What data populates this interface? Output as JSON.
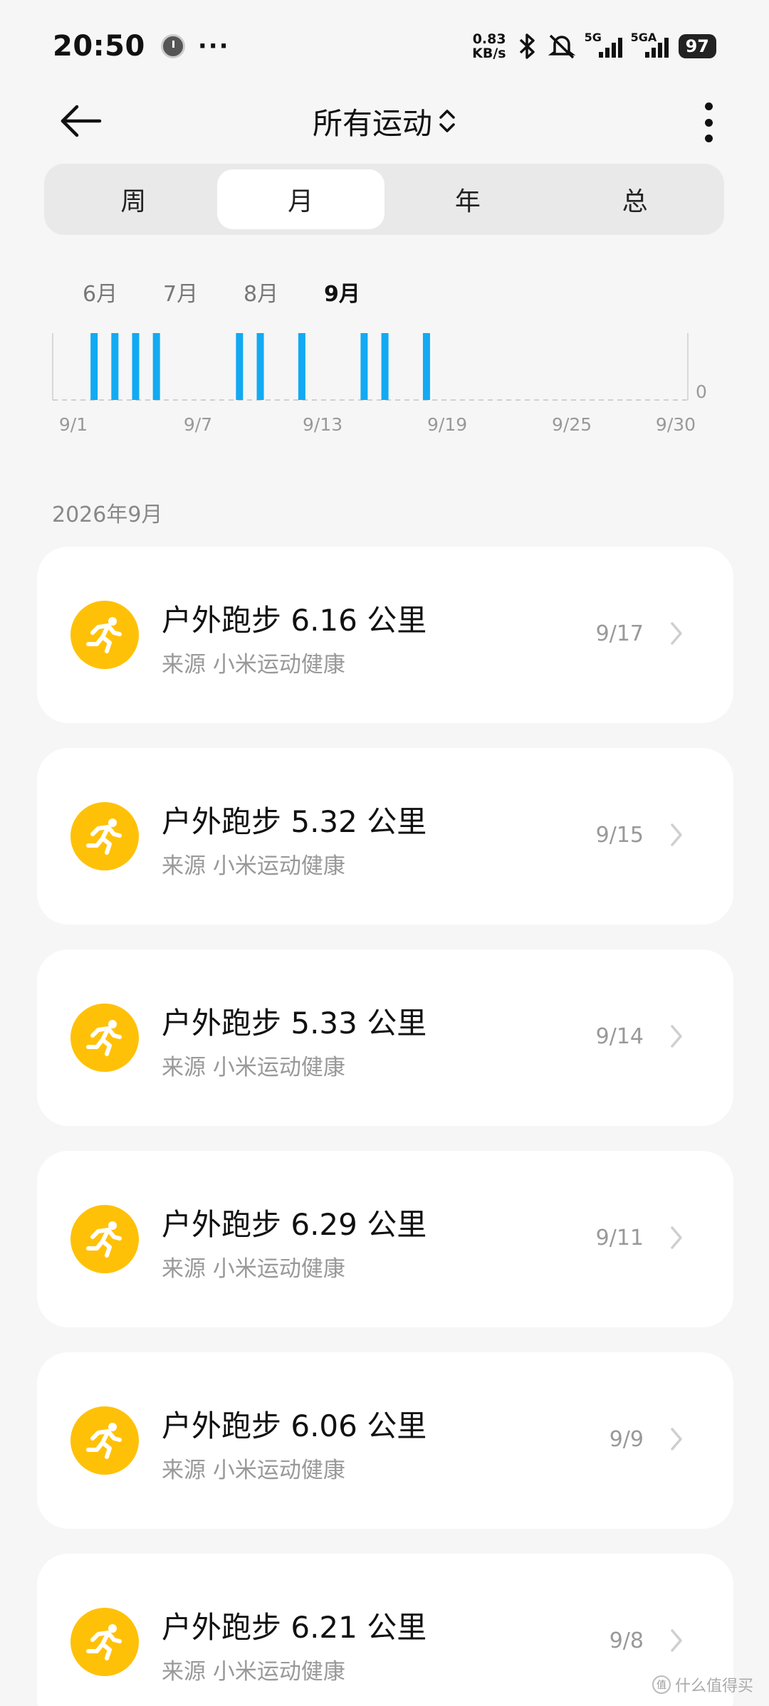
{
  "status_bar": {
    "time": "20:50",
    "dots": "···",
    "net_speed_value": "0.83",
    "net_speed_unit": "KB/s",
    "signal1_label": "5G",
    "signal2_label": "5GA",
    "battery": "97"
  },
  "header": {
    "title": "所有运动"
  },
  "tabs": [
    {
      "label": "周",
      "active": false
    },
    {
      "label": "月",
      "active": true
    },
    {
      "label": "年",
      "active": false
    },
    {
      "label": "总",
      "active": false
    }
  ],
  "chart_data": {
    "type": "bar",
    "months": [
      "6月",
      "7月",
      "8月",
      "9月"
    ],
    "selected_month": "9月",
    "x_tick_labels": [
      "9/1",
      "9/7",
      "9/13",
      "9/19",
      "9/25",
      "9/30"
    ],
    "x_tick_days": [
      1,
      7,
      13,
      19,
      25,
      30
    ],
    "xlim": [
      1,
      30
    ],
    "y_axis_label": "0",
    "active_days": [
      2,
      3,
      4,
      5,
      9,
      10,
      12,
      15,
      16,
      18
    ],
    "bar_color": "#12aaf2"
  },
  "section": {
    "title": "2026年9月"
  },
  "records": [
    {
      "title": "户外跑步 6.16 公里",
      "source": "来源 小米运动健康",
      "date": "9/17"
    },
    {
      "title": "户外跑步 5.32 公里",
      "source": "来源 小米运动健康",
      "date": "9/15"
    },
    {
      "title": "户外跑步 5.33 公里",
      "source": "来源 小米运动健康",
      "date": "9/14"
    },
    {
      "title": "户外跑步 6.29 公里",
      "source": "来源 小米运动健康",
      "date": "9/11"
    },
    {
      "title": "户外跑步 6.06 公里",
      "source": "来源 小米运动健康",
      "date": "9/9"
    },
    {
      "title": "户外跑步 6.21 公里",
      "source": "来源 小米运动健康",
      "date": "9/8"
    }
  ],
  "watermark": {
    "badge": "值",
    "text": "什么值得买"
  },
  "colors": {
    "accent_bar": "#12aaf2",
    "run_icon_bg": "#ffc107"
  }
}
